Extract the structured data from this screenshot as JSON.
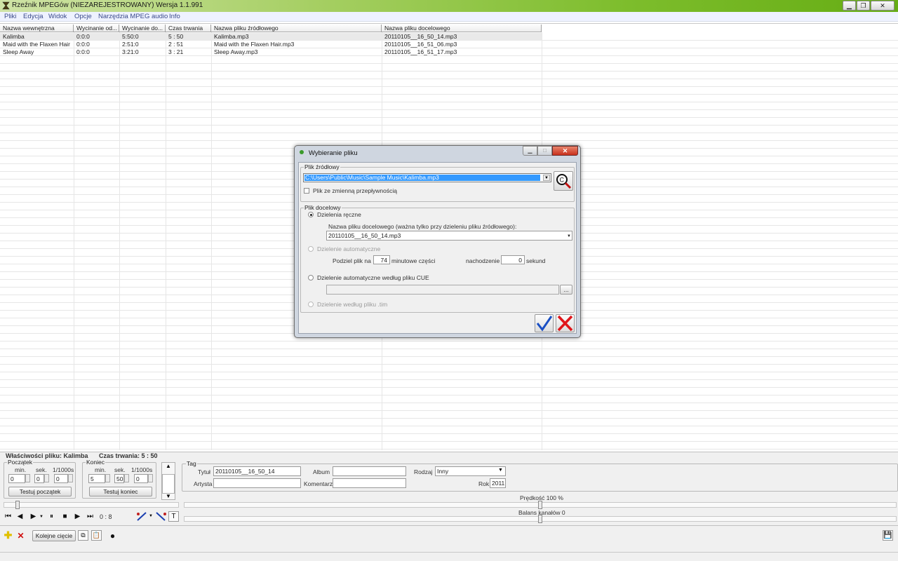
{
  "window": {
    "title": "Rzeźnik MPEGów  (NIEZAREJESTROWANY)  Wersja 1.1.991"
  },
  "menu": [
    "Pliki",
    "Edycja",
    "Widok",
    "Opcje",
    "Narzędzia MPEG audio",
    "Info"
  ],
  "grid": {
    "columns": [
      "Nazwa wewnętrzna",
      "Wycinanie od...",
      "Wycinanie do...",
      "Czas trwania",
      "Nazwa pliku źródłowego",
      "Nazwa pliku docelowego"
    ],
    "rows": [
      [
        "Kalimba",
        "0:0:0",
        "5:50:0",
        "5 : 50",
        "Kalimba.mp3",
        "20110105__16_50_14.mp3"
      ],
      [
        "Maid with the Flaxen Hair",
        "0:0:0",
        "2:51:0",
        "2 : 51",
        "Maid with the Flaxen Hair.mp3",
        "20110105__16_51_06.mp3"
      ],
      [
        "Sleep Away",
        "0:0:0",
        "3:21:0",
        "3 : 21",
        "Sleep Away.mp3",
        "20110105__16_51_17.mp3"
      ]
    ]
  },
  "properties": {
    "file_label": "Właściwości pliku: Kalimba",
    "duration_label": "Czas trwania: 5 : 50",
    "start": {
      "group": "Początek",
      "min_label": "min.",
      "sec_label": "sek.",
      "ms_label": "1/1000s",
      "min": "0",
      "sec": "0",
      "ms": "0",
      "test_button": "Testuj początek"
    },
    "end": {
      "group": "Koniec",
      "min_label": "min.",
      "sec_label": "sek.",
      "ms_label": "1/1000s",
      "min": "5",
      "sec": "50",
      "ms": "0",
      "test_button": "Testuj koniec"
    }
  },
  "tag": {
    "group": "Tag",
    "title_label": "Tytuł",
    "title": "20110105__16_50_14",
    "artist_label": "Artysta",
    "artist": "",
    "album_label": "Album",
    "album": "",
    "comment_label": "Komentarz",
    "comment": "",
    "genre_label": "Rodzaj",
    "genre": "Inny",
    "year_label": "Rok",
    "year": "2011"
  },
  "player": {
    "position": "0 : 8",
    "speed_label": "Prędkość 100 %",
    "balance_label": "Balans kanałów 0"
  },
  "toolbar": {
    "next_cut": "Kolejne cięcie"
  },
  "dialog": {
    "title": "Wybieranie pliku",
    "source_group": "Plik źródłowy",
    "source_path": "C:\\Users\\Public\\Music\\Sample Music\\Kalimba.mp3",
    "vbr_label": "Plik ze zmienną przepływnością",
    "dest_group": "Plik docelowy",
    "manual_label": "Dzielenia ręczne",
    "dest_name_label": "Nazwa pliku docelowego (ważna tylko przy dzieleniu pliku źródłowego):",
    "dest_name": "20110105__16_50_14.mp3",
    "auto_label": "Dzielenie automatyczne",
    "split_label": "Podziel plik na",
    "split_value": "74",
    "split_unit": "minutowe części",
    "overlap_label": "nachodzenie",
    "overlap_value": "0",
    "overlap_unit": "sekund",
    "cue_label": "Dzielenie automatyczne według pliku CUE",
    "cue_path": "",
    "cue_browse": "...",
    "tim_label": "Dzielenie według pliku .tim"
  },
  "colors": {
    "accent_green": "#7dbd2c",
    "selection": "#3399ff",
    "ok": "#1a4fc4",
    "cancel": "#e0161b"
  }
}
